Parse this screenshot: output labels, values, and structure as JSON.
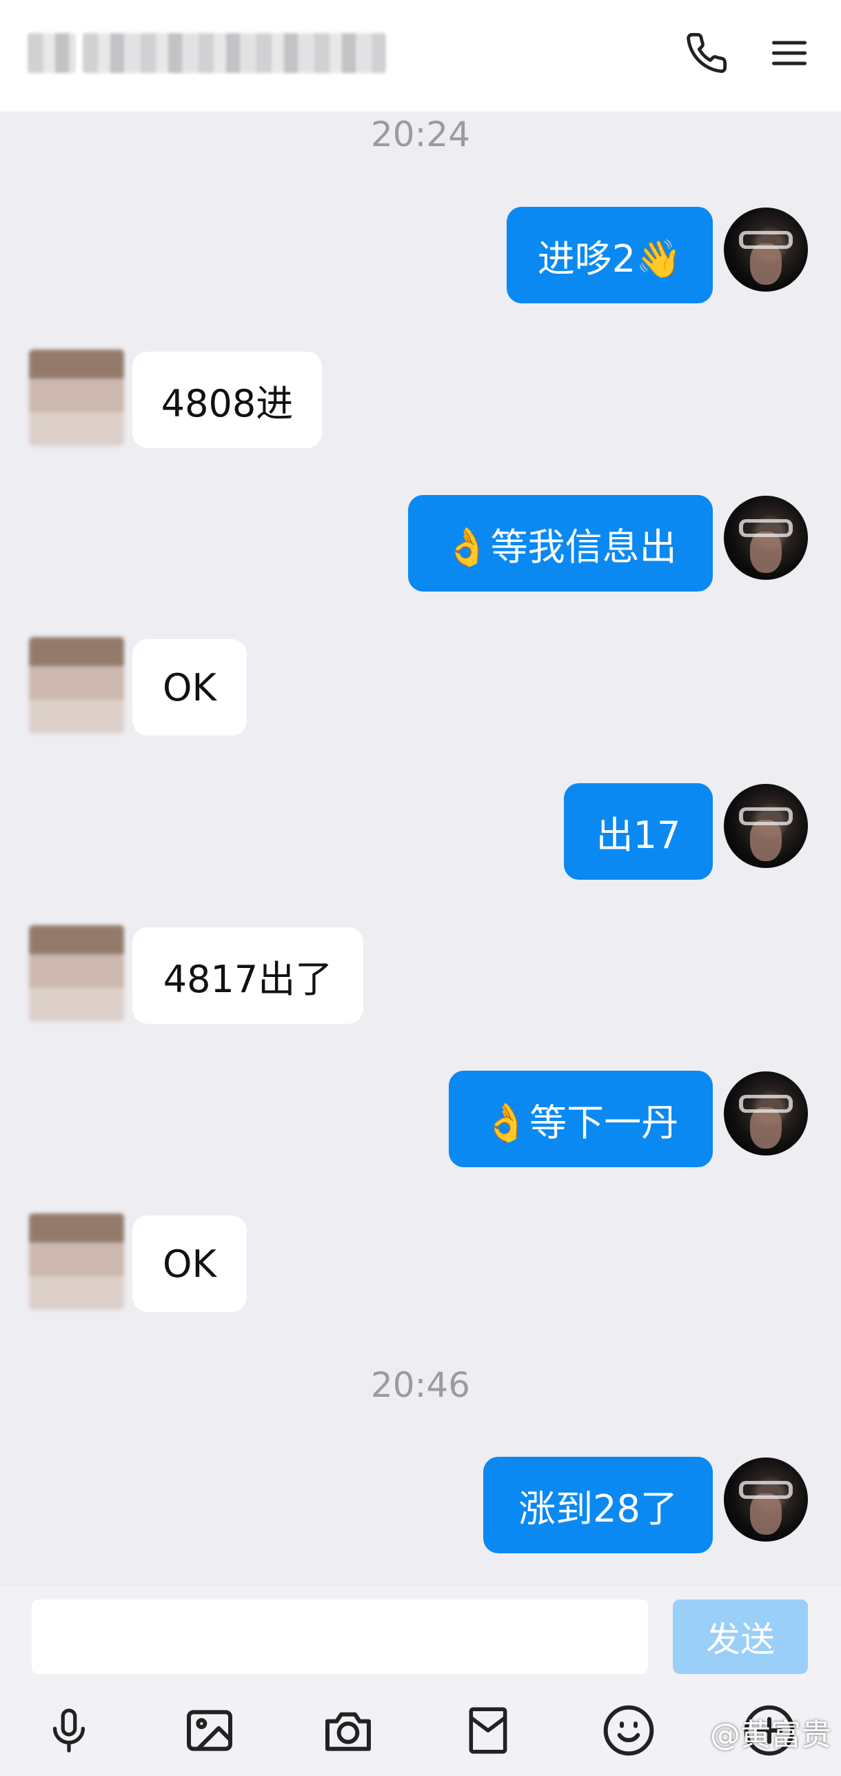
{
  "header": {
    "title": "",
    "call_icon": "phone-icon",
    "menu_icon": "hamburger-menu-icon"
  },
  "chat": {
    "timestamps": [
      "20:24",
      "20:46"
    ],
    "messages": [
      {
        "side": "out",
        "text": "进哆2👋"
      },
      {
        "side": "in",
        "text": "4808进"
      },
      {
        "side": "out",
        "text": "👌等我信息出"
      },
      {
        "side": "in",
        "text": "OK"
      },
      {
        "side": "out",
        "text": "出17"
      },
      {
        "side": "in",
        "text": "4817出了"
      },
      {
        "side": "out",
        "text": "👌等下一丹"
      },
      {
        "side": "in",
        "text": "OK"
      },
      {
        "side": "out",
        "text": "涨到28了"
      }
    ]
  },
  "input_bar": {
    "text_value": "",
    "send_label": "发送",
    "tools": [
      "microphone-icon",
      "image-icon",
      "camera-icon",
      "red-packet-icon",
      "emoji-icon",
      "plus-icon"
    ]
  },
  "watermark": "@黄富贵",
  "colors": {
    "outgoing_bubble": "#0A89F3",
    "incoming_bubble": "#FFFFFF",
    "background": "#EDEDF2",
    "send_button": "#9ACFF8"
  }
}
